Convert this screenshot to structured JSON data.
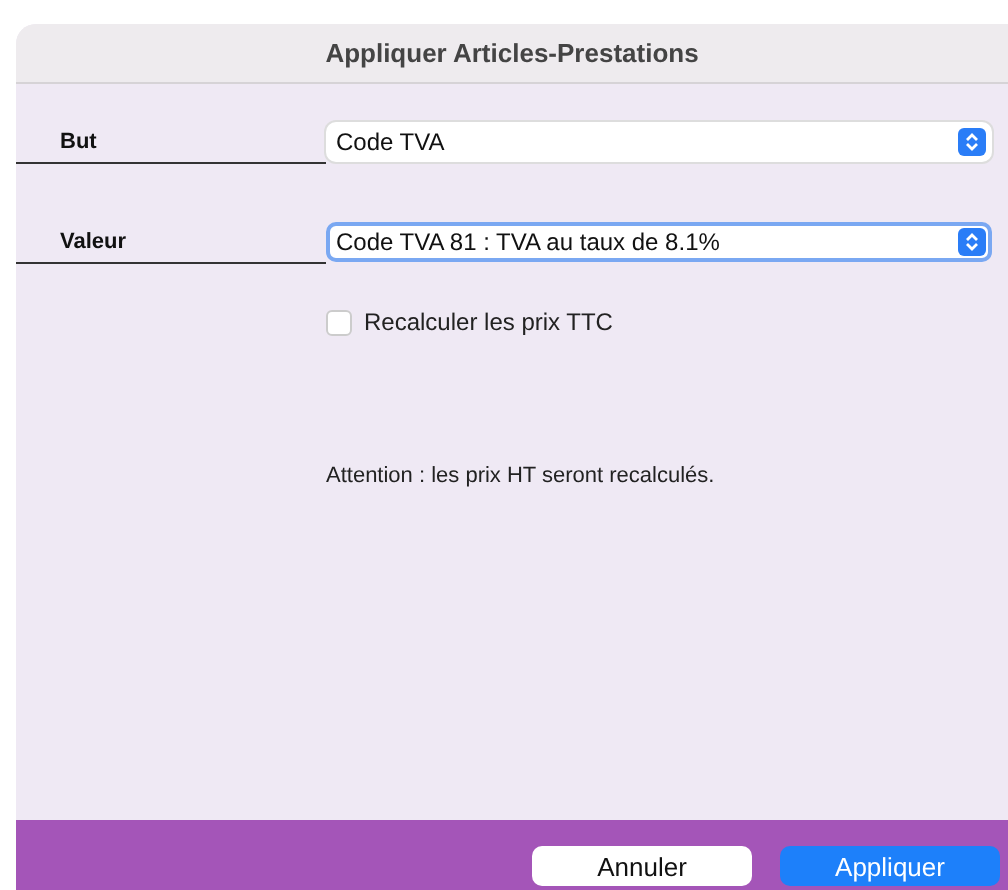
{
  "window": {
    "title": "Appliquer Articles-Prestations"
  },
  "fields": [
    {
      "label": "But",
      "value": "Code TVA",
      "focused": false
    },
    {
      "label": "Valeur",
      "value": "Code TVA 81 : TVA au taux de 8.1%",
      "focused": true
    }
  ],
  "checkbox": {
    "label": "Recalculer les prix TTC",
    "checked": false
  },
  "notice": "Attention : les prix HT seront recalculés.",
  "buttons": [
    {
      "label": "Annuler",
      "kind": "secondary"
    },
    {
      "label": "Appliquer",
      "kind": "primary"
    }
  ]
}
